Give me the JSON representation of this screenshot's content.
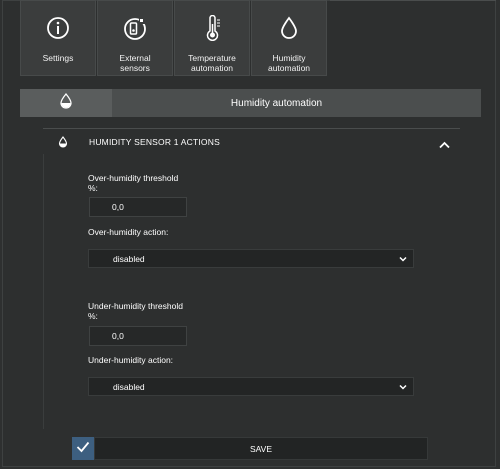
{
  "tabs": [
    {
      "label": "Settings",
      "icon": "info-icon"
    },
    {
      "label": "External\nsensors",
      "icon": "sensor-icon"
    },
    {
      "label": "Temperature\nautomation",
      "icon": "thermometer-icon"
    },
    {
      "label": "Humidity\nautomation",
      "icon": "droplet-icon"
    }
  ],
  "section": {
    "title": "Humidity automation",
    "icon": "droplet-icon"
  },
  "accordion": {
    "title": "HUMIDITY SENSOR 1 ACTIONS",
    "icon": "droplet-icon",
    "toggle_icon": "chevron-up-icon"
  },
  "form": {
    "over_threshold_label": "Over-humidity threshold\n%:",
    "over_threshold_value": "0,0",
    "over_action_label": "Over-humidity action:",
    "over_action_value": "disabled",
    "under_threshold_label": "Under-humidity threshold\n%:",
    "under_threshold_value": "0,0",
    "under_action_label": "Under-humidity action:",
    "under_action_value": "disabled"
  },
  "footer": {
    "save_label": "SAVE",
    "check_icon": "checkmark-icon"
  },
  "colors": {
    "background": "#2e3030",
    "tab": "#3b3d3d",
    "section_bar": "#4b4e4e",
    "check_accent": "#3d5f80",
    "input_bg": "#262828"
  }
}
